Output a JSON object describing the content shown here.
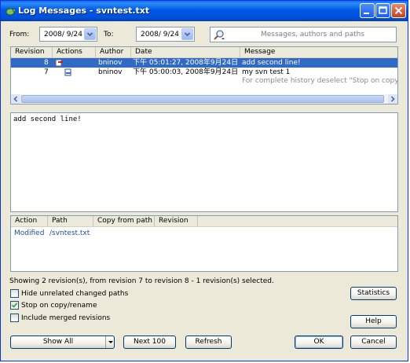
{
  "window": {
    "title": "Log Messages - svntest.txt"
  },
  "filters": {
    "from_label": "From:",
    "from_date": "2008/ 9/24",
    "to_label": "To:",
    "to_date": "2008/ 9/24",
    "search_placeholder": "Messages, authors and paths"
  },
  "revisions": {
    "columns": [
      "Revision",
      "Actions",
      "Author",
      "Date",
      "Message"
    ],
    "rows": [
      {
        "revision": "8",
        "author": "bninov",
        "date": "下午 05:01:27, 2008年9月24日",
        "message": "add second line!"
      },
      {
        "revision": "7",
        "author": "bninov",
        "date": "下午 05:00:03, 2008年9月24日",
        "message": "my svn test 1"
      }
    ],
    "note": "For complete history deselect \"Stop on copy/renam"
  },
  "message_text": "add second line!",
  "paths": {
    "columns": [
      "Action",
      "Path",
      "Copy from path",
      "Revision"
    ],
    "rows": [
      {
        "action": "Modified",
        "path": "/svntest.txt"
      }
    ]
  },
  "status_text": "Showing 2 revision(s), from revision 7 to revision 8 - 1 revision(s) selected.",
  "options": {
    "hide_unrelated": {
      "label": "Hide unrelated changed paths",
      "checked": false
    },
    "stop_on_copy": {
      "label": "Stop on copy/rename",
      "checked": true
    },
    "include_merged": {
      "label": "Include merged revisions",
      "checked": false
    }
  },
  "buttons": {
    "statistics": "Statistics",
    "help": "Help",
    "show_all": "Show All",
    "next_100": "Next 100",
    "refresh": "Refresh",
    "ok": "OK",
    "cancel": "Cancel"
  },
  "colors": {
    "selection": "#316ac5",
    "path_link": "#1f4e9a",
    "note_gray": "#8c8c8c",
    "accent_title": "#0058e6"
  },
  "icons": {
    "title": "turtle-icon",
    "search": "search-magnifier-icon",
    "action_modified": "modified-action-icon"
  }
}
